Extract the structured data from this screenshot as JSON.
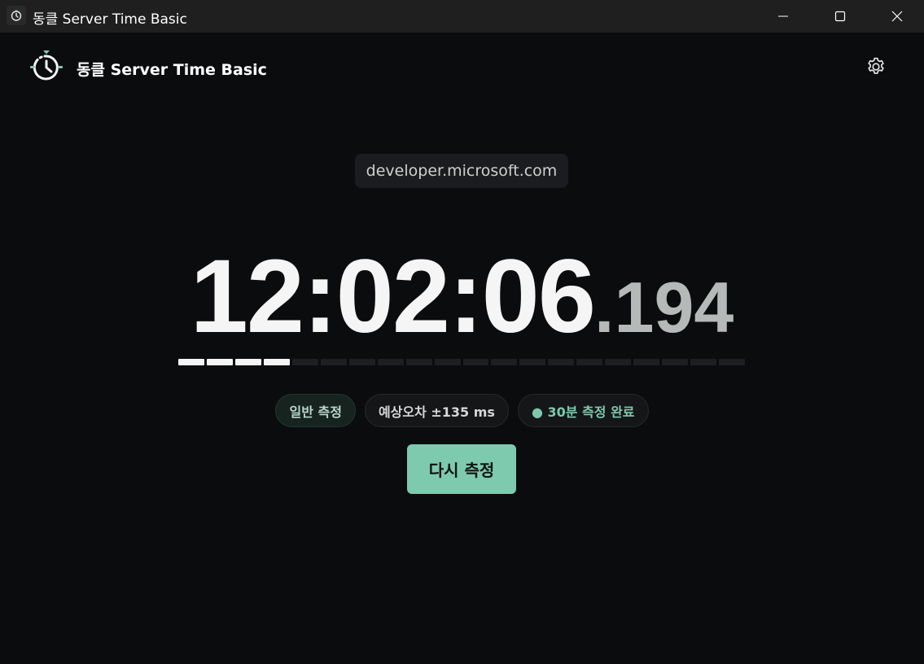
{
  "window": {
    "title": "동클 Server Time Basic"
  },
  "header": {
    "app_name": "동클 Server Time Basic"
  },
  "domain": "developer.microsoft.com",
  "clock": {
    "hms": "12:02:06",
    "separator": ".",
    "ms": "194"
  },
  "progress": {
    "total_segments": 20,
    "filled_segments": 4
  },
  "chips": {
    "mode": "일반 측정",
    "error": "예상오차 ±135 ms",
    "status": "● 30분 측정 완료"
  },
  "actions": {
    "remeasure_label": "다시 측정"
  },
  "colors": {
    "accent": "#7ecaae",
    "background": "#0b0c0e",
    "titlebar": "#1f1f1f"
  },
  "icons": [
    "app-icon",
    "minimize-icon",
    "maximize-icon",
    "close-icon",
    "clock-logo-icon",
    "gear-icon"
  ]
}
